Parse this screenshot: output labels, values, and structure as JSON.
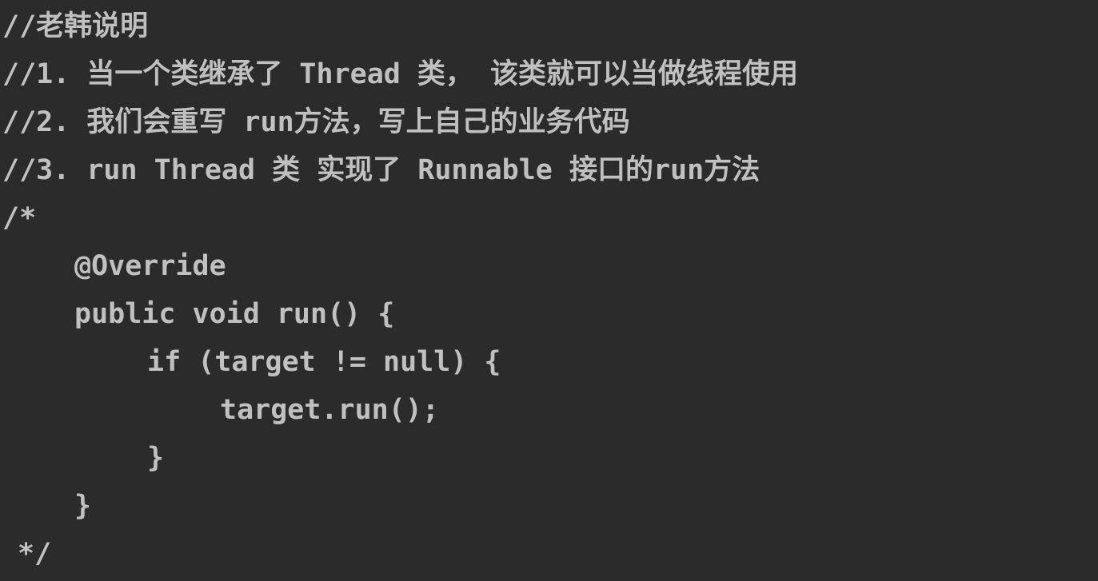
{
  "editor": {
    "lines": [
      "//老韩说明",
      "//1. 当一个类继承了 Thread 类， 该类就可以当做线程使用",
      "//2. 我们会重写 run方法，写上自己的业务代码",
      "//3. run Thread 类 实现了 Runnable 接口的run方法",
      "/*",
      "@Override",
      "public void run() {",
      "if (target != null) {",
      "target.run();",
      "}",
      "}",
      "*/"
    ]
  }
}
